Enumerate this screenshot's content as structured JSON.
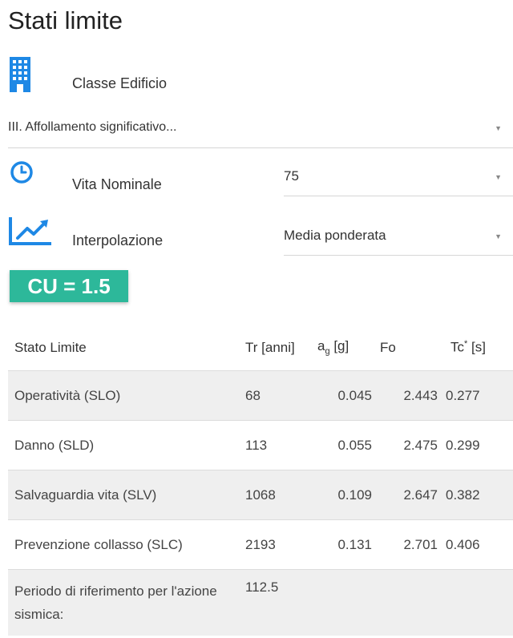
{
  "page": {
    "title": "Stati limite"
  },
  "building_class": {
    "label": "Classe Edificio",
    "icon": "building-icon",
    "value": "III. Affollamento significativo..."
  },
  "nominal_life": {
    "label": "Vita Nominale",
    "icon": "clock-icon",
    "value": "75"
  },
  "interpolation": {
    "label": "Interpolazione",
    "icon": "trending-up-icon",
    "value": "Media ponderata"
  },
  "cu_badge": {
    "text": "CU = 1.5"
  },
  "table": {
    "headers": {
      "state": "Stato Limite",
      "tr": "Tr [anni]",
      "ag_prefix": "a",
      "ag_sub": "g",
      "ag_suffix": " [g]",
      "fo": "Fo",
      "tc_prefix": "Tc",
      "tc_sup": "*",
      "tc_suffix": " [s]"
    },
    "rows": [
      {
        "state": "Operatività (SLO)",
        "tr": "68",
        "ag": "0.045",
        "fo": "2.443",
        "tc": "0.277"
      },
      {
        "state": "Danno (SLD)",
        "tr": "113",
        "ag": "0.055",
        "fo": "2.475",
        "tc": "0.299"
      },
      {
        "state": "Salvaguardia vita (SLV)",
        "tr": "1068",
        "ag": "0.109",
        "fo": "2.647",
        "tc": "0.382"
      },
      {
        "state": "Prevenzione collasso (SLC)",
        "tr": "2193",
        "ag": "0.131",
        "fo": "2.701",
        "tc": "0.406"
      }
    ],
    "reference_period": {
      "label": "Periodo di riferimento per l'azione sismica:",
      "value": "112.5"
    }
  },
  "colors": {
    "icon_blue": "#1e88e5",
    "badge_green": "#2db89a",
    "row_shade": "#efefef"
  }
}
